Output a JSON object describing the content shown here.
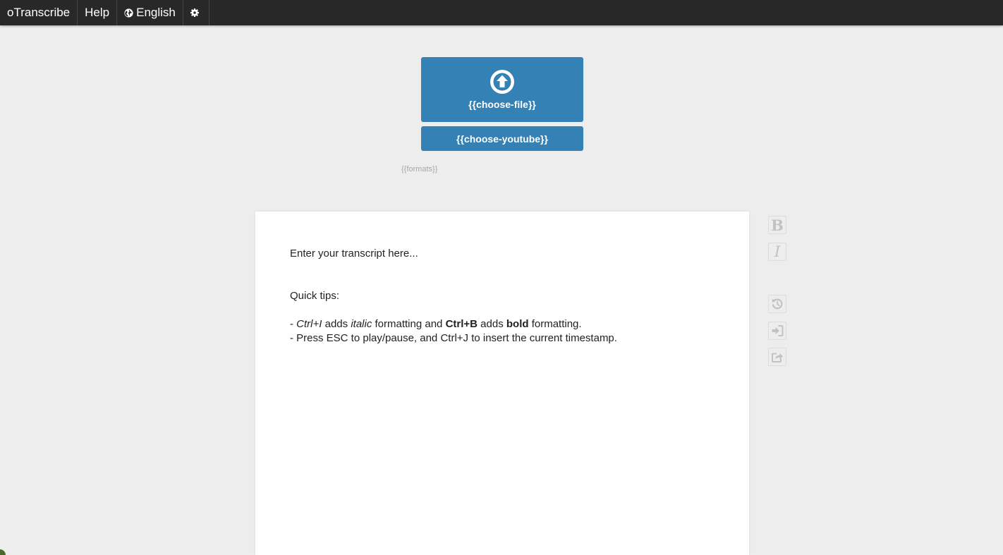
{
  "nav": {
    "brand": "oTranscribe",
    "help": "Help",
    "language": "English",
    "settings_icon": "gear-icon",
    "language_icon": "globe-icon"
  },
  "file": {
    "choose_file": "{{choose-file}}",
    "choose_youtube": "{{choose-youtube}}",
    "formats": "{{formats}}",
    "upload_icon": "upload-arrow-icon"
  },
  "editor": {
    "line1": "Enter your transcript here...",
    "tips_heading": "Quick tips:",
    "tip1": {
      "dash": "- ",
      "ctrl_i": "Ctrl+I",
      "adds1": " adds ",
      "italic": "italic",
      "mid": " formatting and ",
      "ctrl_b": "Ctrl+B",
      "adds2": " adds ",
      "bold": "bold",
      "end": " formatting."
    },
    "tip2": "- Press ESC to play/pause, and Ctrl+J to insert the current timestamp."
  },
  "tools": {
    "bold": "B",
    "italic": "I",
    "icons": [
      "bold-icon",
      "italic-icon",
      "history-icon",
      "import-icon",
      "export-icon"
    ]
  },
  "colors": {
    "topbar": "#282828",
    "accent": "#3381b5",
    "background": "#ededed"
  }
}
